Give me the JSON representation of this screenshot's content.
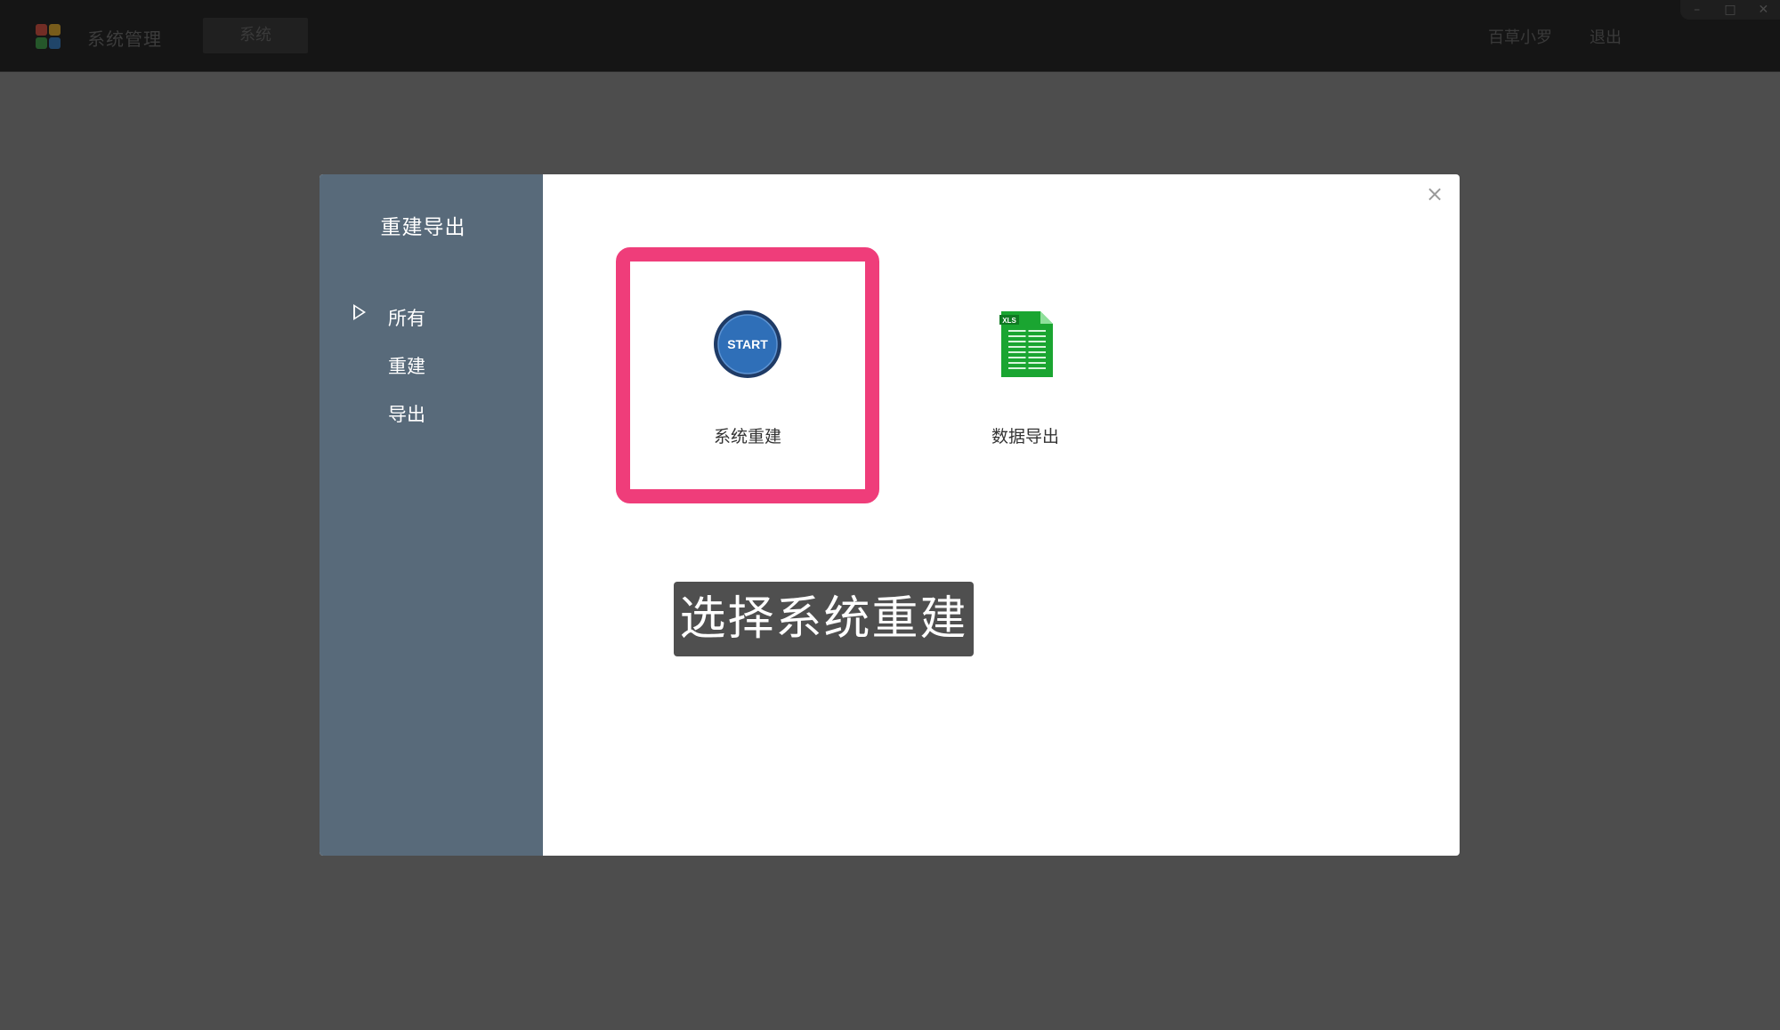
{
  "topbar": {
    "app_title": "系统管理",
    "tab_label": "系统",
    "user": "百草小罗",
    "logout": "退出",
    "window_controls": [
      "minimize-icon",
      "maximize-icon",
      "close-icon"
    ]
  },
  "modal": {
    "sidebar_title": "重建导出",
    "sidebar_items": [
      {
        "label": "所有",
        "selected": true
      },
      {
        "label": "重建",
        "selected": false
      },
      {
        "label": "导出",
        "selected": false
      }
    ],
    "close_icon": "close-icon",
    "cards": [
      {
        "label": "系统重建",
        "icon": "start-icon",
        "icon_text": "START",
        "highlighted": true
      },
      {
        "label": "数据导出",
        "icon": "xls-file-icon",
        "icon_text": "XLS",
        "highlighted": false
      }
    ],
    "caption": "选择系统重建"
  },
  "colors": {
    "highlight": "#ef3d7a",
    "sidebar_bg": "#586a7a",
    "overlay_bg": "#4d4d4d",
    "xls_green": "#1aa531",
    "start_blue": "#2f6fb8"
  }
}
